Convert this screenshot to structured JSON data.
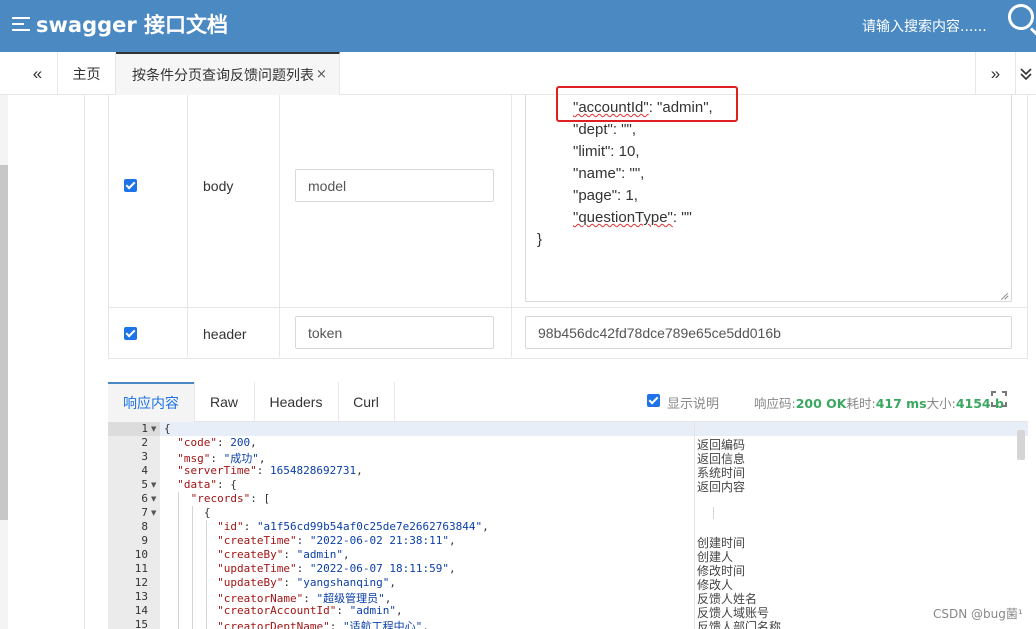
{
  "header": {
    "brand": "swagger 接口文档",
    "search_placeholder": "请输入搜索内容......"
  },
  "tabs": {
    "prev_label": "«",
    "home_label": "主页",
    "active_label": "按条件分页查询反馈问题列表",
    "close_label": "×",
    "next_label": "»"
  },
  "params": [
    {
      "checked": true,
      "name": "body",
      "type_value": "model"
    },
    {
      "checked": true,
      "name": "header",
      "type_value": "token",
      "value": "98b456dc42fd78dce789e65ce5dd016b"
    }
  ],
  "body_json": {
    "line1_key": "\"accountId\"",
    "line1_rest": ": \"admin\",",
    "line2": "\"dept\": \"\",",
    "line3": "\"limit\": 10,",
    "line4": "\"name\": \"\",",
    "line5": "\"page\": 1,",
    "line6_key": "\"questionType\"",
    "line6_rest": ": \"\"",
    "line7": "}"
  },
  "response_tabs": [
    "响应内容",
    "Raw",
    "Headers",
    "Curl"
  ],
  "show_description": {
    "checked": true,
    "label": "显示说明"
  },
  "status": {
    "code_label": "响应码:",
    "code_value": "200 OK",
    "time_label": "耗时:",
    "time_value": "417 ms",
    "size_label": "大小:",
    "size_value": "4154 b"
  },
  "code_lines": [
    {
      "n": "1",
      "fold": true,
      "text": "{",
      "desc": ""
    },
    {
      "n": "2",
      "fold": false,
      "key": "\"code\"",
      "val": "200",
      "tail": ",",
      "desc": "返回编码"
    },
    {
      "n": "3",
      "fold": false,
      "key": "\"msg\"",
      "val": "\"成功\"",
      "tail": ",",
      "desc": "返回信息"
    },
    {
      "n": "4",
      "fold": false,
      "key": "\"serverTime\"",
      "val": "1654828692731",
      "tail": ",",
      "desc": "系统时间"
    },
    {
      "n": "5",
      "fold": true,
      "key": "\"data\"",
      "val": "",
      "tail": "{",
      "desc": "返回内容"
    },
    {
      "n": "6",
      "fold": true,
      "key": "\"records\"",
      "val": "",
      "tail": "[",
      "desc": ""
    },
    {
      "n": "7",
      "fold": true,
      "text": "{",
      "desc": ""
    },
    {
      "n": "8",
      "fold": false,
      "key": "\"id\"",
      "val": "\"a1f56cd99b54af0c25de7e2662763844\"",
      "tail": ",",
      "desc": ""
    },
    {
      "n": "9",
      "fold": false,
      "key": "\"createTime\"",
      "val": "\"2022-06-02 21:38:11\"",
      "tail": ",",
      "desc": "创建时间"
    },
    {
      "n": "10",
      "fold": false,
      "key": "\"createBy\"",
      "val": "\"admin\"",
      "tail": ",",
      "desc": "创建人"
    },
    {
      "n": "11",
      "fold": false,
      "key": "\"updateTime\"",
      "val": "\"2022-06-07 18:11:59\"",
      "tail": ",",
      "desc": "修改时间"
    },
    {
      "n": "12",
      "fold": false,
      "key": "\"updateBy\"",
      "val": "\"yangshanqing\"",
      "tail": ",",
      "desc": "修改人"
    },
    {
      "n": "13",
      "fold": false,
      "key": "\"creatorName\"",
      "val": "\"超级管理员\"",
      "tail": ",",
      "desc": "反馈人姓名"
    },
    {
      "n": "14",
      "fold": false,
      "key": "\"creatorAccountId\"",
      "val": "\"admin\"",
      "tail": ",",
      "desc": "反馈人域账号"
    },
    {
      "n": "15",
      "fold": false,
      "key": "\"creatorDeptName\"",
      "val": "\"适航工程中心\"",
      "tail": ",",
      "desc": "反馈人部门名称"
    }
  ],
  "watermark": "CSDN @bug菌¹",
  "colors": {
    "header_bg": "#4a89c2",
    "checkbox": "#1e73e8",
    "status_green": "#3aa860",
    "highlight_red": "#e02020"
  },
  "icons": [
    "menu-icon",
    "search-icon",
    "close-icon",
    "expand-icon",
    "checkbox-icon",
    "resize-grip-icon"
  ]
}
